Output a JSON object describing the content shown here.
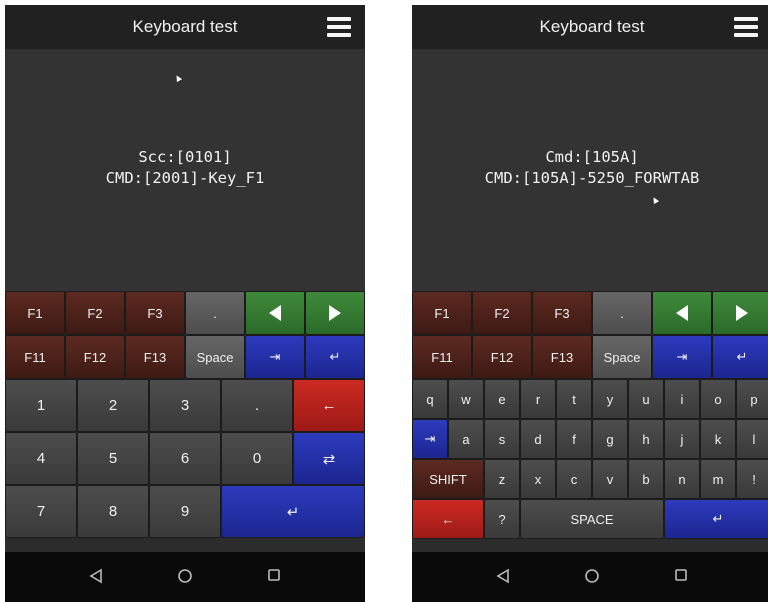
{
  "left": {
    "title": "Keyboard test",
    "display_line1": "Scc:[0101]",
    "display_line2": "CMD:[2001]-Key_F1",
    "fkeys_row1": [
      "F1",
      "F2",
      "F3",
      "."
    ],
    "fkeys_row2": [
      "F11",
      "F12",
      "F13",
      "Space"
    ],
    "numpad": [
      "1",
      "2",
      "3",
      ".",
      "4",
      "5",
      "6",
      "0",
      "7",
      "8",
      "9"
    ]
  },
  "right": {
    "title": "Keyboard test",
    "display_line1": "Cmd:[105A]",
    "display_line2": "CMD:[105A]-5250_FORWTAB",
    "fkeys_row1": [
      "F1",
      "F2",
      "F3",
      "."
    ],
    "fkeys_row2": [
      "F11",
      "F12",
      "F13",
      "Space"
    ],
    "row_q": [
      "q",
      "w",
      "e",
      "r",
      "t",
      "y",
      "u",
      "i",
      "o",
      "p"
    ],
    "row_a": [
      "a",
      "s",
      "d",
      "f",
      "g",
      "h",
      "j",
      "k",
      "l"
    ],
    "row_z": [
      "SHIFT",
      "z",
      "x",
      "c",
      "v",
      "b",
      "n",
      "m",
      "!"
    ],
    "row_bottom": [
      "?",
      "SPACE"
    ]
  },
  "symbols": {
    "tab": "⇥",
    "enter": "↵",
    "backspace": "←",
    "backtab": "⇄"
  },
  "colors": {
    "fkey_red": "#5c2a21",
    "arrow_green": "#3f8a3a",
    "action_blue": "#2c3bbd",
    "backspace_red": "#cc2a22"
  },
  "icons": [
    "menu-icon",
    "back-icon",
    "home-icon",
    "recents-icon",
    "left-arrow-icon",
    "right-arrow-icon",
    "tab-icon",
    "enter-icon",
    "backspace-icon",
    "backtab-icon"
  ]
}
